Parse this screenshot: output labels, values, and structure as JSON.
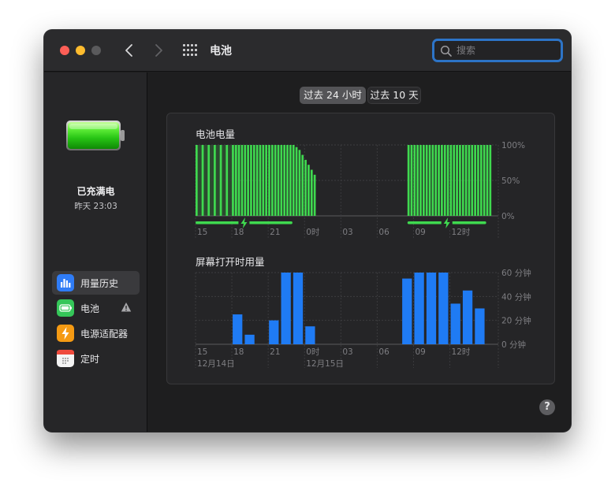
{
  "window": {
    "title": "电池"
  },
  "search": {
    "placeholder": "搜索"
  },
  "sidebar": {
    "status": "已充满电",
    "time": "昨天 23:03",
    "items": [
      {
        "label": "用量历史",
        "icon": "bar-chart-icon",
        "color": "#2f7cf6"
      },
      {
        "label": "电池",
        "icon": "battery-icon",
        "color": "#35c659"
      },
      {
        "label": "电源适配器",
        "icon": "bolt-icon",
        "color": "#f59a13"
      },
      {
        "label": "定时",
        "icon": "calendar-icon",
        "color": "#ef4b3d"
      }
    ]
  },
  "range": {
    "option1": "过去 24 小时",
    "option2": "过去 10 天",
    "selected": "过去 24 小时"
  },
  "colors": {
    "battery_green": "#3fd94f",
    "usage_blue": "#1f7bf4",
    "accent": "#2d74c7"
  },
  "chart_data": [
    {
      "type": "bar",
      "title": "电池电量",
      "x_tick_labels": [
        "15",
        "18",
        "21",
        "0时",
        "03",
        "06",
        "09",
        "12时"
      ],
      "y_tick_labels": [
        "100%",
        "50%",
        "0%"
      ],
      "ylim": [
        0,
        100
      ],
      "x_hours": [
        15,
        15.5,
        16,
        16.5,
        17,
        17.5,
        18,
        18.25,
        18.5,
        18.75,
        19,
        19.25,
        19.5,
        19.75,
        20,
        20.25,
        20.5,
        20.75,
        21,
        21.25,
        21.5,
        21.75,
        22,
        22.25,
        22.5,
        22.75,
        23,
        23.25,
        23.5,
        23.75,
        24,
        24.25,
        24.5,
        24.75,
        32.5,
        32.75,
        33,
        33.25,
        33.5,
        33.75,
        34,
        34.25,
        34.5,
        34.75,
        35,
        35.25,
        35.5,
        35.75,
        36,
        36.25,
        36.5,
        36.75,
        37,
        37.25,
        37.5,
        37.75,
        38,
        38.25,
        38.5,
        38.75,
        39,
        39.25
      ],
      "values": [
        100,
        100,
        100,
        100,
        100,
        100,
        100,
        100,
        100,
        100,
        100,
        100,
        100,
        100,
        100,
        100,
        100,
        100,
        100,
        100,
        100,
        100,
        100,
        100,
        100,
        100,
        100,
        97,
        93,
        86,
        79,
        72,
        65,
        58,
        100,
        100,
        100,
        100,
        100,
        100,
        100,
        100,
        100,
        100,
        100,
        100,
        100,
        100,
        100,
        100,
        100,
        100,
        100,
        100,
        100,
        100,
        100,
        100,
        100,
        100,
        100,
        100
      ],
      "shaded_hours": [
        15,
        18.5
      ],
      "charging_periods": [
        [
          15,
          23
        ],
        [
          32.5,
          39
        ]
      ]
    },
    {
      "type": "bar",
      "title": "屏幕打开时用量",
      "x_tick_labels": [
        "15",
        "18",
        "21",
        "0时",
        "03",
        "06",
        "09",
        "12时"
      ],
      "date_labels": [
        "12月14日",
        "12月15日"
      ],
      "y_tick_labels": [
        "60 分钟",
        "40 分钟",
        "20 分钟",
        "0 分钟"
      ],
      "ylim": [
        0,
        60
      ],
      "x_hours": [
        18,
        19,
        21,
        22,
        23,
        24,
        32,
        33,
        34,
        35,
        36,
        37,
        38
      ],
      "values": [
        25,
        8,
        20,
        60,
        60,
        15,
        55,
        60,
        60,
        60,
        34,
        45,
        30
      ]
    }
  ]
}
